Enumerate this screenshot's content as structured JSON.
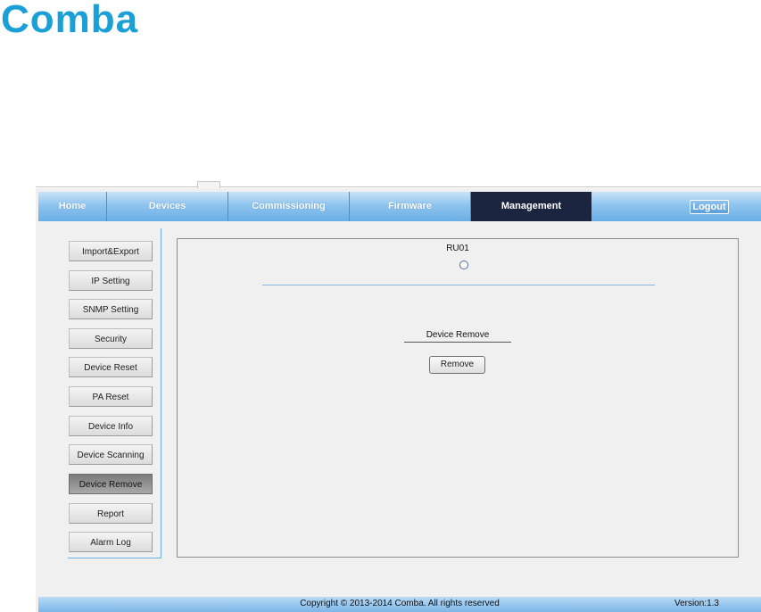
{
  "brand": {
    "logo_text": "Comba",
    "color": "#1aa0d6"
  },
  "nav": {
    "items": [
      {
        "label": "Home"
      },
      {
        "label": "Devices"
      },
      {
        "label": "Commissioning"
      },
      {
        "label": "Firmware"
      },
      {
        "label": "Management",
        "active": true
      }
    ],
    "logout_label": "Logout",
    "active_color": "#1c2540"
  },
  "sidebar": {
    "items": [
      {
        "label": "Import&Export"
      },
      {
        "label": "IP Setting"
      },
      {
        "label": "SNMP Setting"
      },
      {
        "label": "Security"
      },
      {
        "label": "Device Reset"
      },
      {
        "label": "PA Reset"
      },
      {
        "label": "Device Info"
      },
      {
        "label": "Device Scanning"
      },
      {
        "label": "Device Remove",
        "active": true
      },
      {
        "label": "Report"
      },
      {
        "label": "Alarm Log"
      }
    ]
  },
  "main": {
    "device_name": "RU01",
    "device_selected": false,
    "section_title": "Device Remove",
    "remove_label": "Remove"
  },
  "footer": {
    "copyright": "Copyright © 2013-2014 Comba. All rights reserved",
    "version": "Version:1.3"
  }
}
